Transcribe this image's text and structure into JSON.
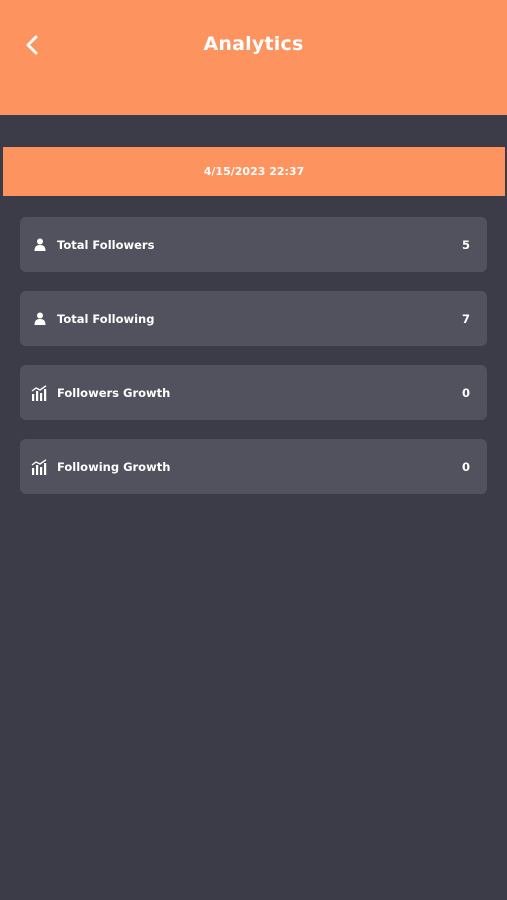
{
  "header": {
    "title": "Analytics",
    "back_icon": "chevron-left-icon",
    "background": "#fd935e"
  },
  "date_bar": {
    "text": "4/15/2023 22:37"
  },
  "stats": [
    {
      "label": "Total Followers",
      "value": "5",
      "icon": "person-icon"
    },
    {
      "label": "Total Following",
      "value": "7",
      "icon": "person-icon"
    },
    {
      "label": "Followers Growth",
      "value": "0",
      "icon": "bar-chart-icon"
    },
    {
      "label": "Following Growth",
      "value": "0",
      "icon": "bar-chart-icon"
    }
  ],
  "colors": {
    "accent": "#fd935e",
    "background": "#3c3c48",
    "card": "#52525e",
    "text": "#ffffff"
  }
}
